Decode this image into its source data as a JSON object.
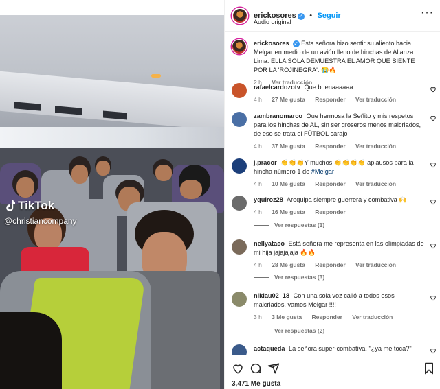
{
  "media": {
    "watermark_app": "TikTok",
    "watermark_handle": "@christiancompany"
  },
  "post": {
    "author": "erickosores",
    "follow_label": "Seguir",
    "audio": "Audio original",
    "caption": "Esta señora hizo sentir su aliento hacia Melgar en medio de un avión lleno de hinchas de Alianza Lima. ELLA SOLA DEMUESTRA EL AMOR QUE SIENTE POR LA 'ROJINEGRA'. 😭🔥",
    "caption_time": "2 h",
    "caption_translate": "Ver traducción",
    "likes": "3,471 Me gusta"
  },
  "comments": [
    {
      "user": "rafaelcardozotv",
      "text": "Que buenaaaaaa",
      "time": "4 h",
      "likes": "27 Me gusta",
      "reply": "Responder",
      "translate": "Ver traducción",
      "avatar_color": "#c9542a"
    },
    {
      "user": "zambranomarco",
      "text": "Que hermosa la Señito y mis respetos para los hinchas de AL, sin ser groseros menos malcriados, de eso se trata el FÚTBOL carajo",
      "time": "4 h",
      "likes": "37 Me gusta",
      "reply": "Responder",
      "translate": "Ver traducción",
      "avatar_color": "#4a6fa5"
    },
    {
      "user": "j.pracor",
      "text": "👏👏👏Y muchos 👏👏👏👏 apiausos para la hincha número 1 de",
      "tag": "#Melgar",
      "time": "4 h",
      "likes": "10 Me gusta",
      "reply": "Responder",
      "translate": "Ver traducción",
      "avatar_color": "#1c3f7a"
    },
    {
      "user": "yquiroz28",
      "text": "Arequipa siempre guerrera y combativa 🙌",
      "time": "4 h",
      "likes": "16 Me gusta",
      "reply": "Responder",
      "replies": "Ver respuestas (1)",
      "avatar_color": "#6b6b6b"
    },
    {
      "user": "nellyataco",
      "text": "Está señora me representa en las olimpiadas de mi hija jajajajaja 🔥🔥",
      "time": "4 h",
      "likes": "28 Me gusta",
      "reply": "Responder",
      "translate": "Ver traducción",
      "replies": "Ver respuestas (3)",
      "avatar_color": "#7a6a5a"
    },
    {
      "user": "niklau02_18",
      "text": "Con una sola voz calló a todos esos malcriados, vamos Melgar !!!!",
      "time": "3 h",
      "likes": "3 Me gusta",
      "reply": "Responder",
      "translate": "Ver traducción",
      "replies": "Ver respuestas (2)",
      "avatar_color": "#8a8a6a"
    },
    {
      "user": "actaqueda",
      "text": "La señora super-combativa. \"¿ya me toca?\" Esa",
      "avatar_color": "#3a5a8a"
    }
  ],
  "colors": {
    "accent": "#0095f6",
    "verified": "#3897f0",
    "meta_text": "#737373"
  },
  "icons": [
    "more-icon",
    "heart-icon",
    "comment-icon",
    "share-icon",
    "bookmark-icon",
    "tiktok-icon"
  ]
}
